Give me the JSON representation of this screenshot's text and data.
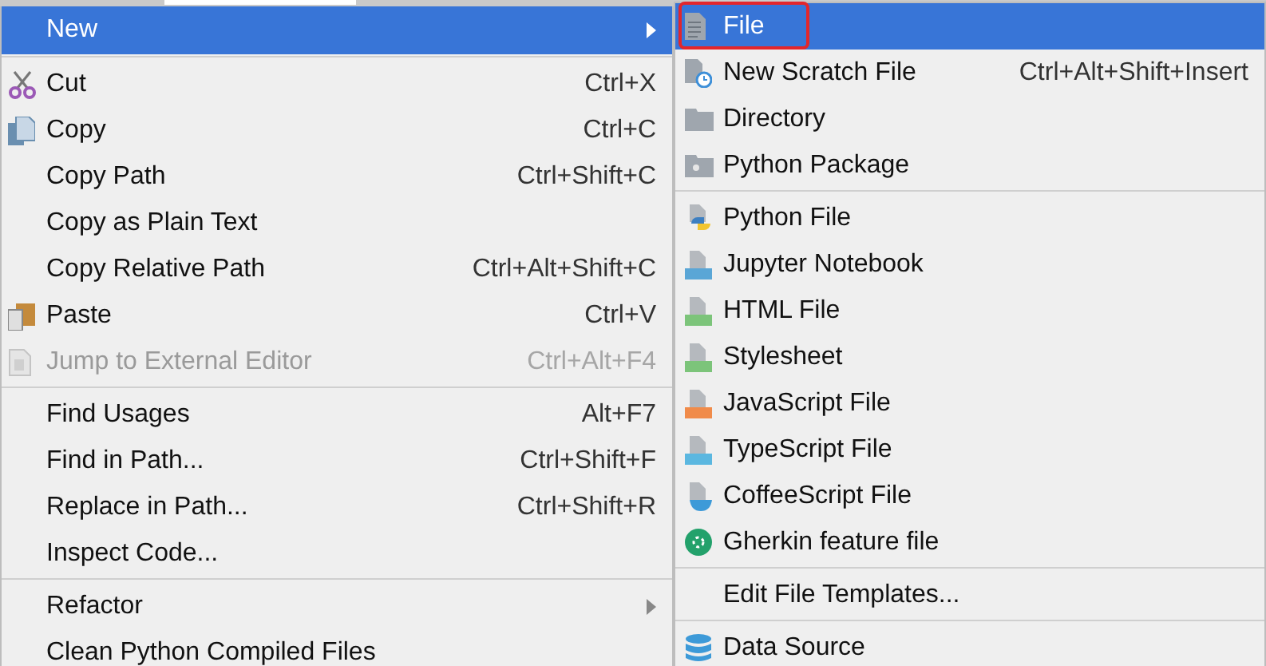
{
  "context_menu": {
    "sections": [
      {
        "items": [
          {
            "label": "New",
            "has_submenu": true,
            "disabled": false,
            "selected": true
          }
        ]
      },
      {
        "items": [
          {
            "label": "Cut",
            "shortcut": "Ctrl+X",
            "has_submenu": false,
            "disabled": false,
            "selected": false
          },
          {
            "label": "Copy",
            "shortcut": "Ctrl+C",
            "has_submenu": false,
            "disabled": false,
            "selected": false
          },
          {
            "label": "Copy Path",
            "shortcut": "Ctrl+Shift+C",
            "has_submenu": false,
            "disabled": false,
            "selected": false
          },
          {
            "label": "Copy as Plain Text",
            "has_submenu": false,
            "disabled": false,
            "selected": false
          },
          {
            "label": "Copy Relative Path",
            "shortcut": "Ctrl+Alt+Shift+C",
            "has_submenu": false,
            "disabled": false,
            "selected": false
          },
          {
            "label": "Paste",
            "shortcut": "Ctrl+V",
            "has_submenu": false,
            "disabled": false,
            "selected": false
          },
          {
            "label": "Jump to External Editor",
            "shortcut": "Ctrl+Alt+F4",
            "has_submenu": false,
            "disabled": true,
            "selected": false
          }
        ]
      },
      {
        "items": [
          {
            "label": "Find Usages",
            "shortcut": "Alt+F7",
            "has_submenu": false,
            "disabled": false,
            "selected": false
          },
          {
            "label": "Find in Path...",
            "shortcut": "Ctrl+Shift+F",
            "has_submenu": false,
            "disabled": false,
            "selected": false
          },
          {
            "label": "Replace in Path...",
            "shortcut": "Ctrl+Shift+R",
            "has_submenu": false,
            "disabled": false,
            "selected": false
          },
          {
            "label": "Inspect Code...",
            "has_submenu": false,
            "disabled": false,
            "selected": false
          }
        ]
      },
      {
        "items": [
          {
            "label": "Refactor",
            "has_submenu": true,
            "disabled": false,
            "selected": false
          },
          {
            "label": "Clean Python Compiled Files",
            "has_submenu": false,
            "disabled": false,
            "selected": false
          }
        ]
      }
    ]
  },
  "submenu": {
    "sections": [
      {
        "items": [
          {
            "label": "File",
            "selected": true,
            "annotated": true
          },
          {
            "label": "New Scratch File",
            "shortcut": "Ctrl+Alt+Shift+Insert",
            "selected": false,
            "annotated": false
          },
          {
            "label": "Directory",
            "selected": false,
            "annotated": false
          },
          {
            "label": "Python Package",
            "selected": false,
            "annotated": false
          }
        ]
      },
      {
        "items": [
          {
            "label": "Python File",
            "selected": false,
            "annotated": false
          },
          {
            "label": "Jupyter Notebook",
            "selected": false,
            "annotated": false
          },
          {
            "label": "HTML File",
            "selected": false,
            "annotated": false
          },
          {
            "label": "Stylesheet",
            "selected": false,
            "annotated": false
          },
          {
            "label": "JavaScript File",
            "selected": false,
            "annotated": false
          },
          {
            "label": "TypeScript File",
            "selected": false,
            "annotated": false
          },
          {
            "label": "CoffeeScript File",
            "selected": false,
            "annotated": false
          },
          {
            "label": "Gherkin feature file",
            "selected": false,
            "annotated": false
          }
        ]
      },
      {
        "items": [
          {
            "label": "Edit File Templates...",
            "selected": false,
            "annotated": false
          }
        ]
      },
      {
        "items": [
          {
            "label": "Data Source",
            "selected": false,
            "annotated": false
          }
        ]
      }
    ]
  }
}
